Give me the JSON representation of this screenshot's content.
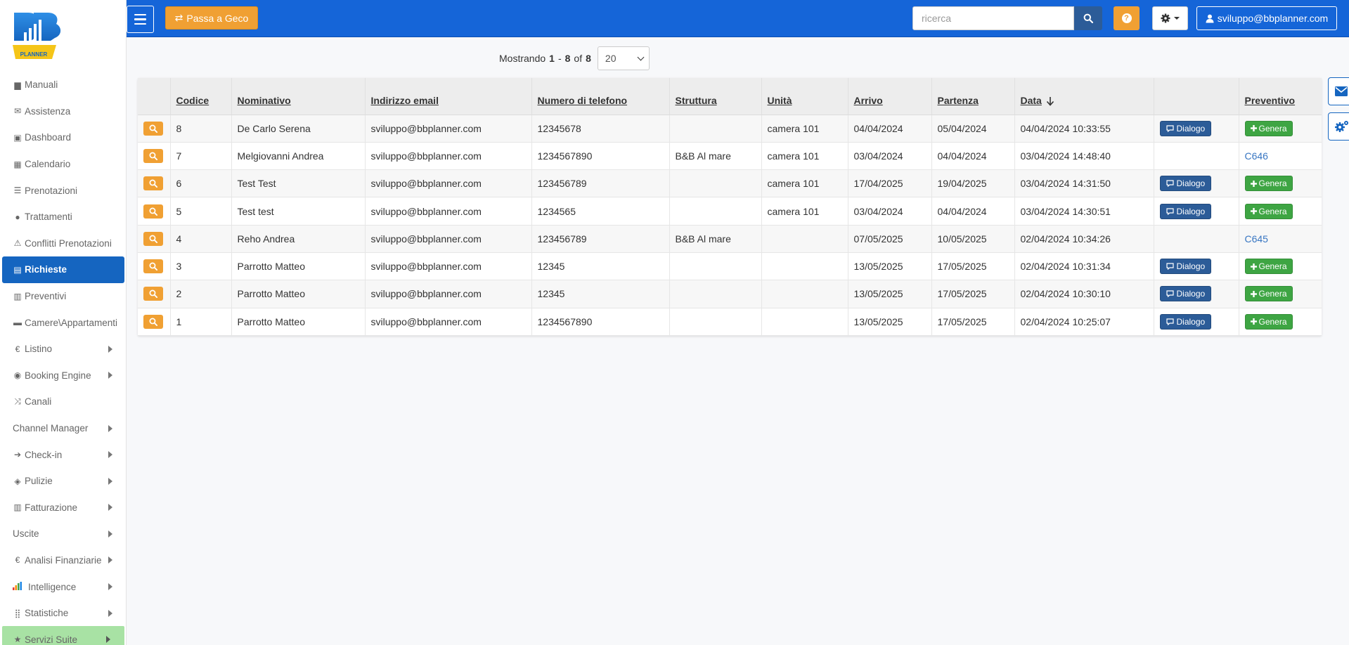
{
  "brand": {
    "logo_text": "PLANNER"
  },
  "sidebar": {
    "items": [
      {
        "label": "Manuali",
        "icon": "book-icon",
        "glyph": "▆",
        "chevron": false
      },
      {
        "label": "Assistenza",
        "icon": "envelope-icon",
        "glyph": "✉",
        "chevron": false
      },
      {
        "label": "Dashboard",
        "icon": "hdd-icon",
        "glyph": "▣",
        "chevron": false
      },
      {
        "label": "Calendario",
        "icon": "calendar-icon",
        "glyph": "▦",
        "chevron": false
      },
      {
        "label": "Prenotazioni",
        "icon": "list-icon",
        "glyph": "☰",
        "chevron": false
      },
      {
        "label": "Trattamenti",
        "icon": "apple-icon",
        "glyph": "●",
        "chevron": false
      },
      {
        "label": "Conflitti Prenotazioni",
        "icon": "warning-icon",
        "glyph": "⚠",
        "chevron": false
      },
      {
        "label": "Richieste",
        "icon": "inbox-icon",
        "glyph": "▤",
        "chevron": false,
        "active": true
      },
      {
        "label": "Preventivi",
        "icon": "list-alt-icon",
        "glyph": "▥",
        "chevron": false
      },
      {
        "label": "Camere\\Appartamenti",
        "icon": "bed-icon",
        "glyph": "▬",
        "chevron": false
      },
      {
        "label": "Listino",
        "icon": "euro-icon",
        "glyph": "€",
        "chevron": true
      },
      {
        "label": "Booking Engine",
        "icon": "globe-icon",
        "glyph": "◉",
        "chevron": true
      },
      {
        "label": "Canali",
        "icon": "random-icon",
        "glyph": "⤨",
        "chevron": false
      },
      {
        "label": "Channel Manager",
        "icon": "",
        "glyph": "",
        "chevron": true
      },
      {
        "label": "Check-in",
        "icon": "log-in-icon",
        "glyph": "➔",
        "chevron": true
      },
      {
        "label": "Pulizie",
        "icon": "erase-icon",
        "glyph": "◈",
        "chevron": true
      },
      {
        "label": "Fatturazione",
        "icon": "list-alt-icon",
        "glyph": "▥",
        "chevron": true
      },
      {
        "label": "Uscite",
        "icon": "",
        "glyph": "",
        "chevron": true
      },
      {
        "label": "Analisi Finanziarie",
        "icon": "euro-icon",
        "glyph": "€",
        "chevron": true
      },
      {
        "label": "Intelligence",
        "icon": "bar-chart-icon",
        "glyph": "",
        "chevron": true
      },
      {
        "label": "Statistiche",
        "icon": "tasks-icon",
        "glyph": "⣿",
        "chevron": true
      },
      {
        "label": "Servizi Suite",
        "icon": "star-icon",
        "glyph": "★",
        "chevron": true,
        "suite": true
      }
    ]
  },
  "topbar": {
    "geco_label": "Passa a Geco",
    "search_placeholder": "ricerca",
    "help_glyph": "?",
    "user_label": "sviluppo@bbplanner.com"
  },
  "pager": {
    "prefix": "Mostrando",
    "from": "1",
    "dash": "-",
    "to": "8",
    "of": "of",
    "total": "8",
    "page_size": "20"
  },
  "table": {
    "headers": [
      "Codice",
      "Nominativo",
      "Indirizzo email",
      "Numero di telefono",
      "Struttura",
      "Unità",
      "Arrivo",
      "Partenza",
      "Data",
      "",
      "Preventivo"
    ],
    "dialogo_label": "Dialogo",
    "genera_label": "Genera",
    "rows": [
      {
        "code": "8",
        "name": "De Carlo Serena",
        "email": "sviluppo@bbplanner.com",
        "phone": "12345678",
        "struttura": "",
        "unita": "camera 101",
        "arrivo": "04/04/2024",
        "partenza": "05/04/2024",
        "data": "04/04/2024 10:33:55",
        "dialogo": true,
        "preventivo": null
      },
      {
        "code": "7",
        "name": "Melgiovanni Andrea",
        "email": "sviluppo@bbplanner.com",
        "phone": "1234567890",
        "struttura": "B&B Al mare",
        "unita": "camera 101",
        "arrivo": "03/04/2024",
        "partenza": "04/04/2024",
        "data": "03/04/2024 14:48:40",
        "dialogo": false,
        "preventivo": "C646"
      },
      {
        "code": "6",
        "name": "Test Test",
        "email": "sviluppo@bbplanner.com",
        "phone": "123456789",
        "struttura": "",
        "unita": "camera 101",
        "arrivo": "17/04/2025",
        "partenza": "19/04/2025",
        "data": "03/04/2024 14:31:50",
        "dialogo": true,
        "preventivo": null
      },
      {
        "code": "5",
        "name": "Test test",
        "email": "sviluppo@bbplanner.com",
        "phone": "1234565",
        "struttura": "",
        "unita": "camera 101",
        "arrivo": "03/04/2024",
        "partenza": "04/04/2024",
        "data": "03/04/2024 14:30:51",
        "dialogo": true,
        "preventivo": null
      },
      {
        "code": "4",
        "name": "Reho Andrea",
        "email": "sviluppo@bbplanner.com",
        "phone": "123456789",
        "struttura": "B&B Al mare",
        "unita": "",
        "arrivo": "07/05/2025",
        "partenza": "10/05/2025",
        "data": "02/04/2024 10:34:26",
        "dialogo": false,
        "preventivo": "C645"
      },
      {
        "code": "3",
        "name": "Parrotto Matteo",
        "email": "sviluppo@bbplanner.com",
        "phone": "12345",
        "struttura": "",
        "unita": "",
        "arrivo": "13/05/2025",
        "partenza": "17/05/2025",
        "data": "02/04/2024 10:31:34",
        "dialogo": true,
        "preventivo": null
      },
      {
        "code": "2",
        "name": "Parrotto Matteo",
        "email": "sviluppo@bbplanner.com",
        "phone": "12345",
        "struttura": "",
        "unita": "",
        "arrivo": "13/05/2025",
        "partenza": "17/05/2025",
        "data": "02/04/2024 10:30:10",
        "dialogo": true,
        "preventivo": null
      },
      {
        "code": "1",
        "name": "Parrotto Matteo",
        "email": "sviluppo@bbplanner.com",
        "phone": "1234567890",
        "struttura": "",
        "unita": "",
        "arrivo": "13/05/2025",
        "partenza": "17/05/2025",
        "data": "02/04/2024 10:25:07",
        "dialogo": true,
        "preventivo": null
      }
    ]
  },
  "colors": {
    "primary": "#1565d8",
    "orange": "#f0a033",
    "dark_blue": "#2c5c98",
    "green": "#3ea543",
    "active_menu": "#1565c0",
    "suite_bg": "#a8e2a4",
    "link": "#3876c2"
  }
}
